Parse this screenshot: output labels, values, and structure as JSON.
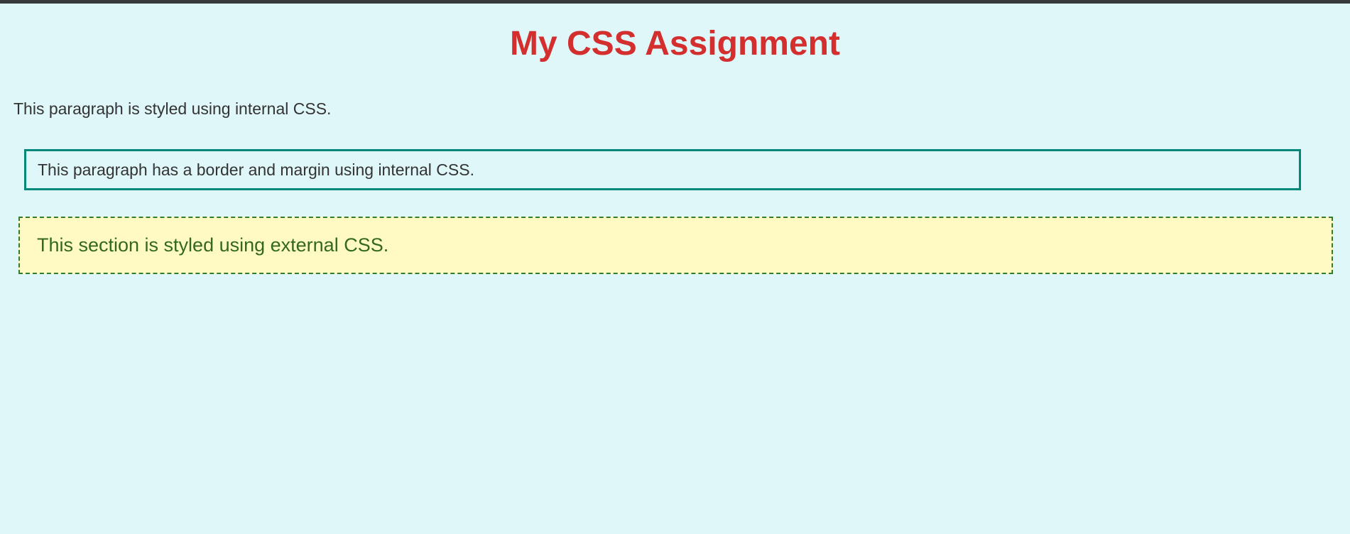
{
  "page": {
    "title": "My CSS Assignment",
    "internal_paragraph": "This paragraph is styled using internal CSS.",
    "bordered_paragraph": "This paragraph has a border and margin using internal CSS.",
    "external_section_text": "This section is styled using external CSS."
  },
  "colors": {
    "background": "#e0f7fa",
    "title": "#d32f2f",
    "body_text": "#333333",
    "border_teal": "#00897b",
    "section_background": "#fff9c4",
    "section_border": "#2e7d32",
    "section_text": "#33691e"
  }
}
